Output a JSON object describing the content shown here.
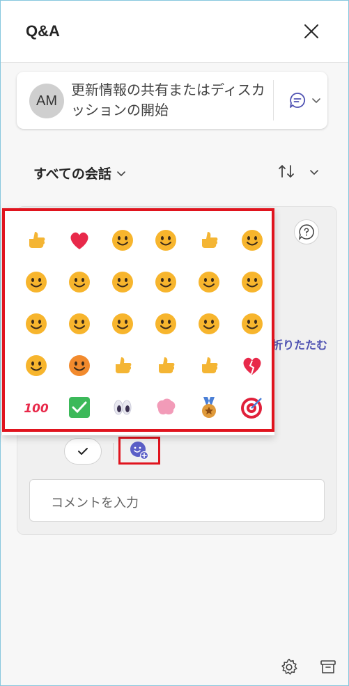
{
  "header": {
    "title": "Q&A"
  },
  "composer": {
    "avatar_initials": "AM",
    "text": "更新情報の共有またはディスカッションの開始"
  },
  "filter": {
    "label": "すべての会話"
  },
  "card": {
    "collapse_label": "折りたたむ"
  },
  "comment": {
    "placeholder": "コメントを入力"
  },
  "emoji_picker": {
    "items": [
      {
        "name": "thumbs-up",
        "color": "#f4b534"
      },
      {
        "name": "heart",
        "color": "#e8294a"
      },
      {
        "name": "grinning",
        "color": "#f7b52d"
      },
      {
        "name": "party",
        "color": "#f7b52d"
      },
      {
        "name": "clapping",
        "color": "#f4b534"
      },
      {
        "name": "pleading",
        "color": "#f7b52d"
      },
      {
        "name": "laughing-squint",
        "color": "#f7b52d"
      },
      {
        "name": "big-grin",
        "color": "#f7b52d"
      },
      {
        "name": "smiling",
        "color": "#f7b52d"
      },
      {
        "name": "rofl",
        "color": "#f7b52d"
      },
      {
        "name": "upside-down",
        "color": "#f7b52d"
      },
      {
        "name": "star-struck",
        "color": "#f7b52d"
      },
      {
        "name": "zany",
        "color": "#f7b52d"
      },
      {
        "name": "thinking",
        "color": "#f7b52d"
      },
      {
        "name": "astonished",
        "color": "#f7b52d"
      },
      {
        "name": "mind-blown",
        "color": "#f7b52d"
      },
      {
        "name": "fearful",
        "color": "#f7b52d"
      },
      {
        "name": "crying",
        "color": "#f7b52d"
      },
      {
        "name": "screaming",
        "color": "#f7b52d"
      },
      {
        "name": "angry",
        "color": "#f28a2d"
      },
      {
        "name": "point-up",
        "color": "#f4b534"
      },
      {
        "name": "raising-hands",
        "color": "#f4b534"
      },
      {
        "name": "writing-hand",
        "color": "#f4b534"
      },
      {
        "name": "broken-heart",
        "color": "#e8294a"
      },
      {
        "name": "hundred",
        "color": "#e8294a"
      },
      {
        "name": "check-box",
        "color": "#3cb95a"
      },
      {
        "name": "eyes",
        "color": "#c9c9d8"
      },
      {
        "name": "brain",
        "color": "#f29bb8"
      },
      {
        "name": "medal",
        "color": "#e09a3a"
      },
      {
        "name": "target",
        "color": "#e0203a"
      }
    ]
  },
  "colors": {
    "accent": "#4f52b2",
    "highlight": "#e0141e"
  }
}
